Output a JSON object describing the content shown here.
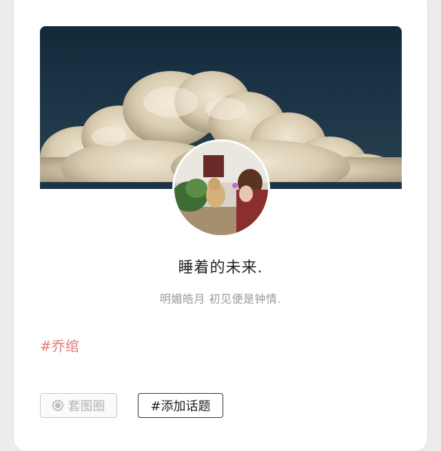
{
  "profile": {
    "name": "睡着的未来.",
    "bio": "明媚皓月 初见便是钟情."
  },
  "post": {
    "hashtag": "#乔绾"
  },
  "actions": {
    "circle_label": "套图圈",
    "add_topic_label": "#添加话题"
  },
  "colors": {
    "hashtag": "#e47a7a",
    "cover_sky": "#1c3546"
  },
  "icons": {
    "circle": "radio-circle-icon"
  }
}
